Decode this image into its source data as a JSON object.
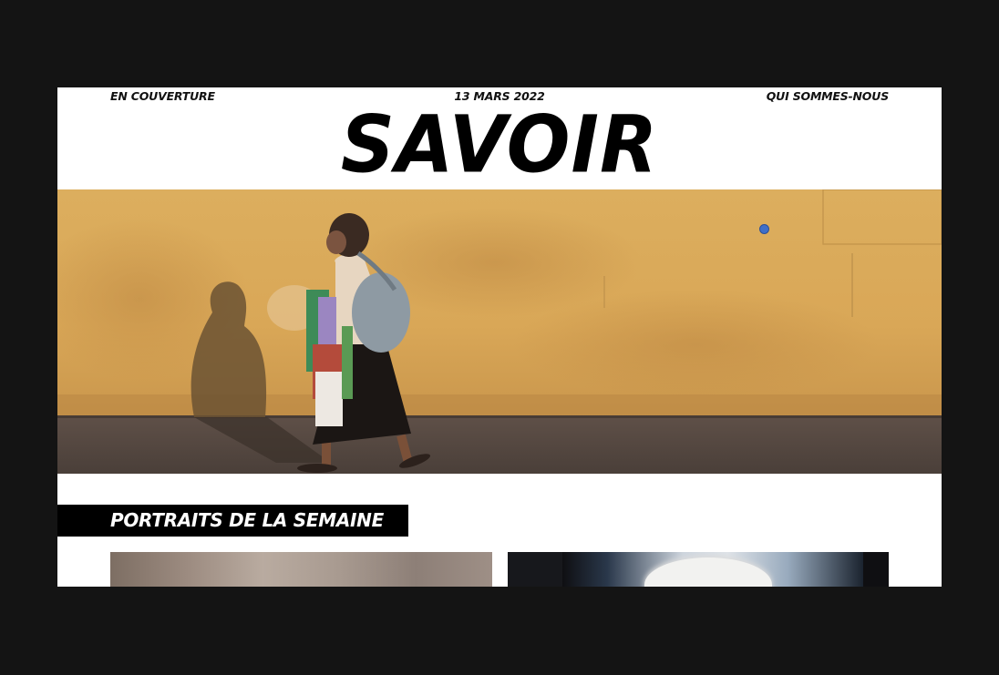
{
  "header": {
    "nav_left": "EN COUVERTURE",
    "date": "13 MARS 2022",
    "nav_right": "QUI SOMMES-NOUS",
    "logo": "SAVOIR"
  },
  "hero": {
    "image": "woman-walking-past-ochre-wall-photo"
  },
  "section": {
    "title": "PORTRAITS DE LA SEMAINE"
  },
  "portraits": [
    {
      "image": "portrait-photo-1"
    },
    {
      "image": "portrait-photo-2"
    }
  ],
  "colors": {
    "page_background": "#141414",
    "paper": "#ffffff",
    "ink": "#000000",
    "wall_ochre": "#d7a654",
    "cursor_dot": "#3f6fc8"
  }
}
